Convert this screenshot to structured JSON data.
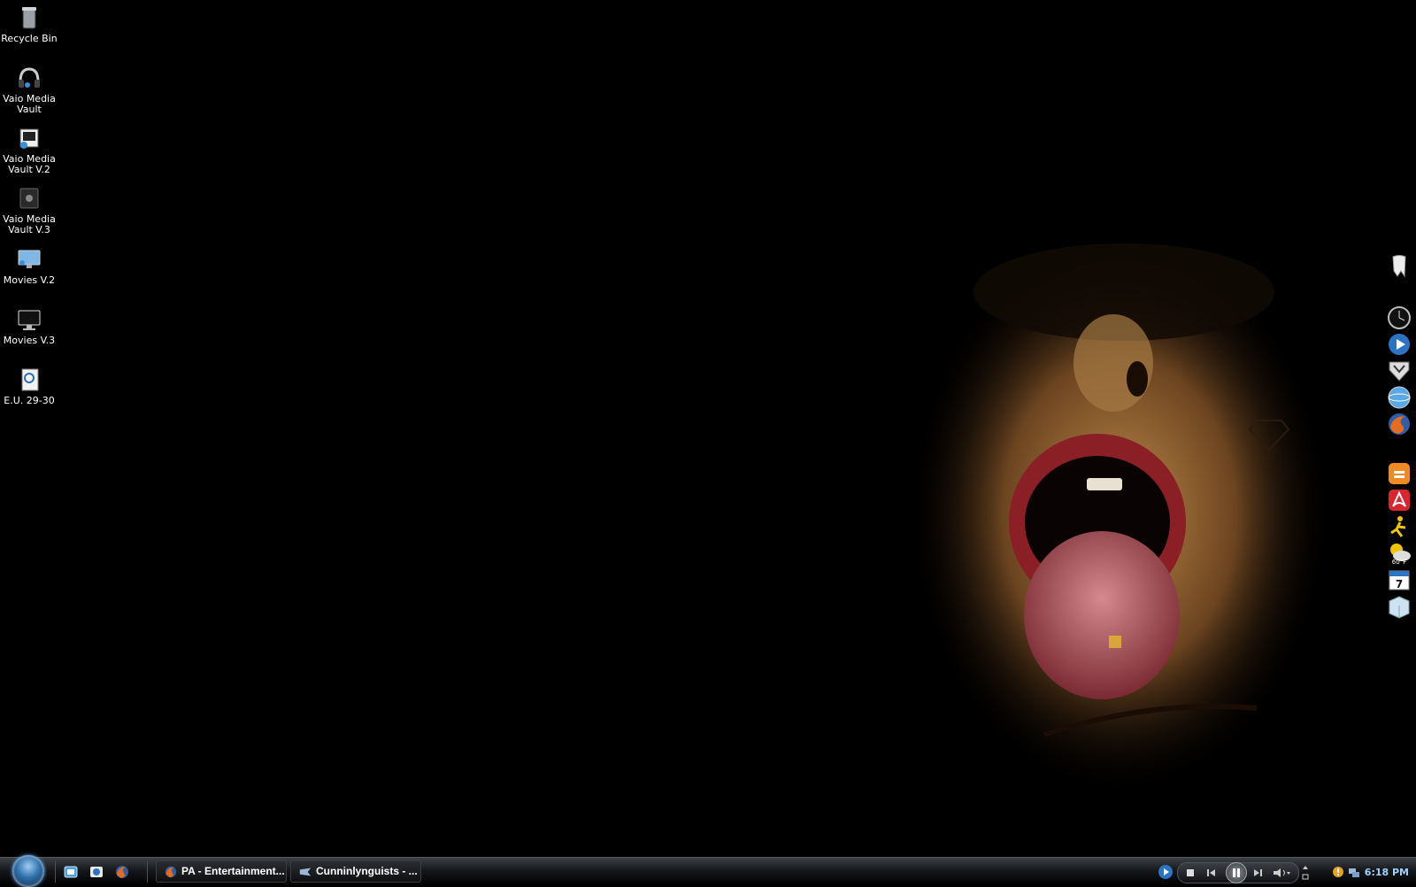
{
  "desktop": {
    "icons": [
      {
        "label": "Recycle Bin",
        "icon": "recycle-bin-icon"
      },
      {
        "label": "Vaio Media Vault",
        "icon": "headphones-icon"
      },
      {
        "label": "Vaio Media Vault V.2",
        "icon": "media-folder-icon"
      },
      {
        "label": "Vaio Media Vault V.3",
        "icon": "dark-folder-icon"
      },
      {
        "label": "Movies V.2",
        "icon": "monitor-icon"
      },
      {
        "label": "Movies V.3",
        "icon": "monitor-black-icon"
      },
      {
        "label": "E.U. 29-30",
        "icon": "document-icon"
      }
    ]
  },
  "dock": {
    "items": [
      "tooth-icon",
      "clock-icon",
      "media-player-icon",
      "shield-icon",
      "globe-icon",
      "firefox-icon",
      "blogger-icon",
      "acrobat-icon",
      "aim-icon",
      "weather-icon",
      "calendar-icon",
      "box-icon"
    ],
    "weather_text": "60°F",
    "calendar_text": "7"
  },
  "taskbar": {
    "quick_launch": [
      "show-desktop-icon",
      "media-icon",
      "firefox-icon"
    ],
    "buttons": [
      {
        "label": "PA - Entertainment...",
        "icon": "firefox-icon"
      },
      {
        "label": "Cunninlynguists - ...",
        "icon": "media-player-icon"
      }
    ],
    "clock": "6:18 PM"
  },
  "colors": {
    "accent": "#9fd0ff",
    "taskbar": "#15171a"
  }
}
